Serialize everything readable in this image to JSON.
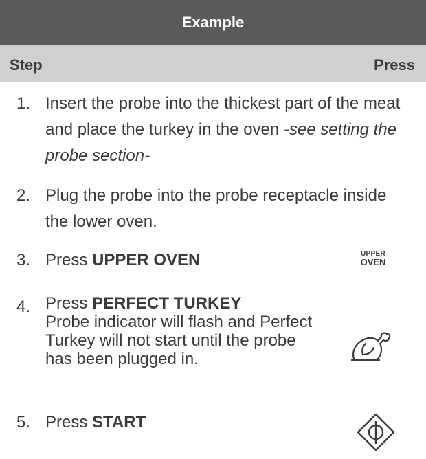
{
  "title": "Example",
  "headers": {
    "step": "Step",
    "press": "Press"
  },
  "steps": [
    {
      "number": "1.",
      "text": "Insert the probe into the thickest part of the meat and place the turkey in the oven ",
      "note": "-see setting the probe section-"
    },
    {
      "number": "2.",
      "text": "Plug the probe into the probe receptacle inside the lower oven."
    },
    {
      "number": "3.",
      "prefix": "Press ",
      "bold": "UPPER OVEN",
      "press_icon": "upper-oven-key"
    },
    {
      "number": "4.",
      "prefix": "Press ",
      "bold": "PERFECT TURKEY",
      "text": "Probe indicator will flash and Perfect Turkey will not start until the probe has been plugged in.",
      "press_icon": "turkey-icon"
    },
    {
      "number": "5.",
      "prefix": "Press ",
      "bold": "START",
      "press_icon": "start-icon"
    }
  ],
  "keys": {
    "upper_oven_line1": "UPPER",
    "upper_oven_line2": "OVEN"
  },
  "colors": {
    "title_bar": "#5a5a5a",
    "header_bar": "#d0d0d0",
    "text": "#3a3a3a"
  }
}
